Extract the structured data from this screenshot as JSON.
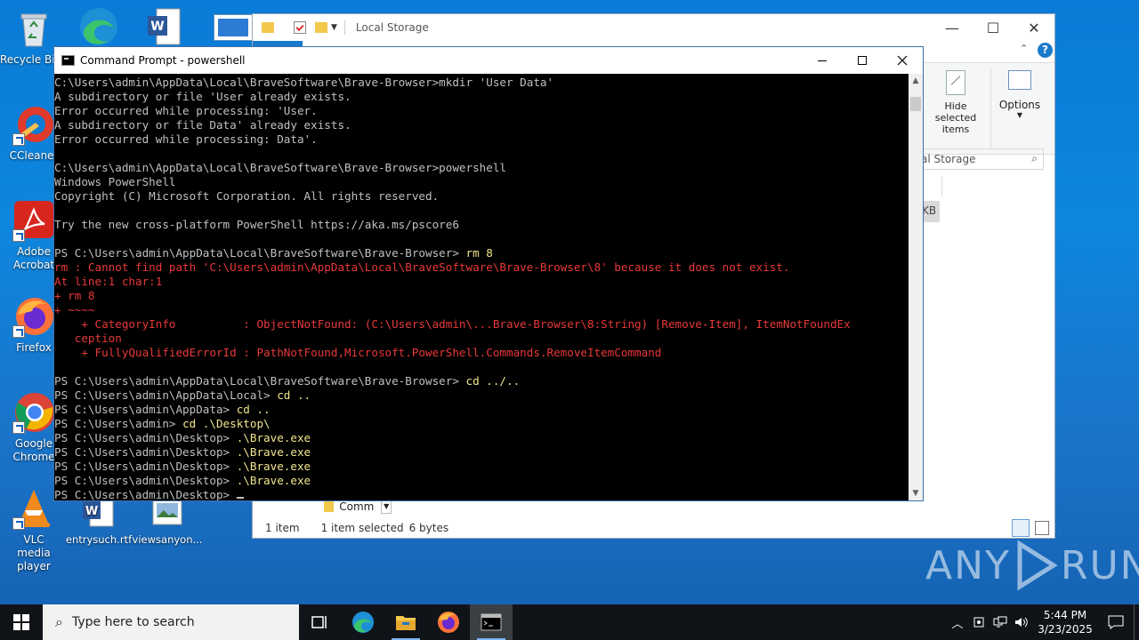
{
  "desktop": {
    "icons": [
      {
        "label": "Recycle Bin",
        "icon": "recycle-bin-icon"
      },
      {
        "label": "CCleaner",
        "icon": "ccleaner-icon"
      },
      {
        "label": "Adobe Acrobat",
        "icon": "adobe-acrobat-icon"
      },
      {
        "label": "Firefox",
        "icon": "firefox-icon"
      },
      {
        "label": "Google Chrome",
        "icon": "chrome-icon"
      },
      {
        "label": "VLC media player",
        "icon": "vlc-icon"
      },
      {
        "label": "entrysuch.rtf",
        "icon": "word-document-icon"
      },
      {
        "label": "viewsanyon...",
        "icon": "image-file-icon"
      }
    ]
  },
  "explorer": {
    "address": "Local Storage",
    "ribbon": {
      "hide_selected": "Hide selected items",
      "options": "Options"
    },
    "search_placeholder": "al Storage",
    "kb_badge": "KB",
    "file_row": "Comm",
    "status": {
      "count": "1 item",
      "selected": "1 item selected",
      "size": "6 bytes"
    }
  },
  "cmd": {
    "title": "Command Prompt - powershell",
    "lines": [
      {
        "t": "C:\\Users\\admin\\AppData\\Local\\BraveSoftware\\Brave-Browser>mkdir 'User Data'",
        "k": "out"
      },
      {
        "t": "A subdirectory or file 'User already exists.",
        "k": "out"
      },
      {
        "t": "Error occurred while processing: 'User.",
        "k": "out"
      },
      {
        "t": "A subdirectory or file Data' already exists.",
        "k": "out"
      },
      {
        "t": "Error occurred while processing: Data'.",
        "k": "out"
      },
      {
        "t": "",
        "k": "out"
      },
      {
        "t": "C:\\Users\\admin\\AppData\\Local\\BraveSoftware\\Brave-Browser>powershell",
        "k": "out"
      },
      {
        "t": "Windows PowerShell",
        "k": "out"
      },
      {
        "t": "Copyright (C) Microsoft Corporation. All rights reserved.",
        "k": "out"
      },
      {
        "t": "",
        "k": "out"
      },
      {
        "t": "Try the new cross-platform PowerShell https://aka.ms/pscore6",
        "k": "out"
      },
      {
        "t": "",
        "k": "out"
      },
      {
        "p": "PS C:\\Users\\admin\\AppData\\Local\\BraveSoftware\\Brave-Browser> ",
        "c": "rm 8",
        "k": "ps"
      },
      {
        "t": "rm : Cannot find path 'C:\\Users\\admin\\AppData\\Local\\BraveSoftware\\Brave-Browser\\8' because it does not exist.",
        "k": "err"
      },
      {
        "t": "At line:1 char:1",
        "k": "err"
      },
      {
        "t": "+ rm 8",
        "k": "err"
      },
      {
        "t": "+ ~~~~",
        "k": "err"
      },
      {
        "t": "    + CategoryInfo          : ObjectNotFound: (C:\\Users\\admin\\...Brave-Browser\\8:String) [Remove-Item], ItemNotFoundEx",
        "k": "err"
      },
      {
        "t": "   ception",
        "k": "err"
      },
      {
        "t": "    + FullyQualifiedErrorId : PathNotFound,Microsoft.PowerShell.Commands.RemoveItemCommand",
        "k": "err"
      },
      {
        "t": "",
        "k": "out"
      },
      {
        "p": "PS C:\\Users\\admin\\AppData\\Local\\BraveSoftware\\Brave-Browser> ",
        "c": "cd ../..",
        "k": "ps"
      },
      {
        "p": "PS C:\\Users\\admin\\AppData\\Local> ",
        "c": "cd ..",
        "k": "ps"
      },
      {
        "p": "PS C:\\Users\\admin\\AppData> ",
        "c": "cd ..",
        "k": "ps"
      },
      {
        "p": "PS C:\\Users\\admin> ",
        "c": "cd .\\Desktop\\",
        "k": "ps"
      },
      {
        "p": "PS C:\\Users\\admin\\Desktop> ",
        "c": ".\\Brave.exe",
        "k": "ps"
      },
      {
        "p": "PS C:\\Users\\admin\\Desktop> ",
        "c": ".\\Brave.exe",
        "k": "ps"
      },
      {
        "p": "PS C:\\Users\\admin\\Desktop> ",
        "c": ".\\Brave.exe",
        "k": "ps"
      },
      {
        "p": "PS C:\\Users\\admin\\Desktop> ",
        "c": ".\\Brave.exe",
        "k": "ps"
      },
      {
        "p": "PS C:\\Users\\admin\\Desktop> ",
        "c": "",
        "k": "prompt"
      }
    ],
    "colors": {
      "text": "#c0c0c0",
      "error": "#e8383a",
      "command": "#f0e68c",
      "background": "#000000"
    }
  },
  "taskbar": {
    "search_placeholder": "Type here to search",
    "apps": [
      "task-view-icon",
      "edge-icon",
      "file-explorer-icon",
      "firefox-icon",
      "cmd-icon"
    ],
    "time": "5:44 PM",
    "date": "3/23/2025"
  },
  "watermark": {
    "text_left": "ANY",
    "text_right": "RUN"
  }
}
